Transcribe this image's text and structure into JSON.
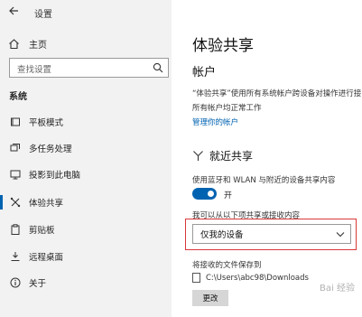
{
  "window": {
    "title": "设置"
  },
  "sidebar": {
    "home_label": "主页",
    "search_placeholder": "查找设置",
    "section_title": "系统",
    "items": [
      {
        "label": "平板模式",
        "icon": "tablet-icon"
      },
      {
        "label": "多任务处理",
        "icon": "multitask-icon"
      },
      {
        "label": "投影到此电脑",
        "icon": "project-icon"
      },
      {
        "label": "体验共享",
        "icon": "share-icon",
        "active": true
      },
      {
        "label": "剪贴板",
        "icon": "clipboard-icon"
      },
      {
        "label": "远程桌面",
        "icon": "remote-desktop-icon"
      },
      {
        "label": "关于",
        "icon": "info-icon"
      }
    ]
  },
  "main": {
    "page_title": "体验共享",
    "accounts_heading": "帐户",
    "accounts_text_line1": "“体验共享”使用所有系统帐户跨设备对操作进行接",
    "accounts_text_line2": "所有帐户均正常工作",
    "manage_link": "管理你的帐户",
    "nearby_heading": "就近共享",
    "nearby_desc": "使用蓝牙和 WLAN 与附近的设备共享内容",
    "toggle_state": "开",
    "share_label": "我可以从以下项共享或接收内容",
    "share_selected": "仅我的设备",
    "save_label": "将接收的文件保存到",
    "save_path": "C:\\Users\\abc98\\Downloads",
    "change_button": "更改"
  },
  "colors": {
    "accent": "#0063b1",
    "highlight": "#d9383a",
    "sidebar_bg": "#f2f2f2"
  },
  "watermark": "Bai 经验"
}
